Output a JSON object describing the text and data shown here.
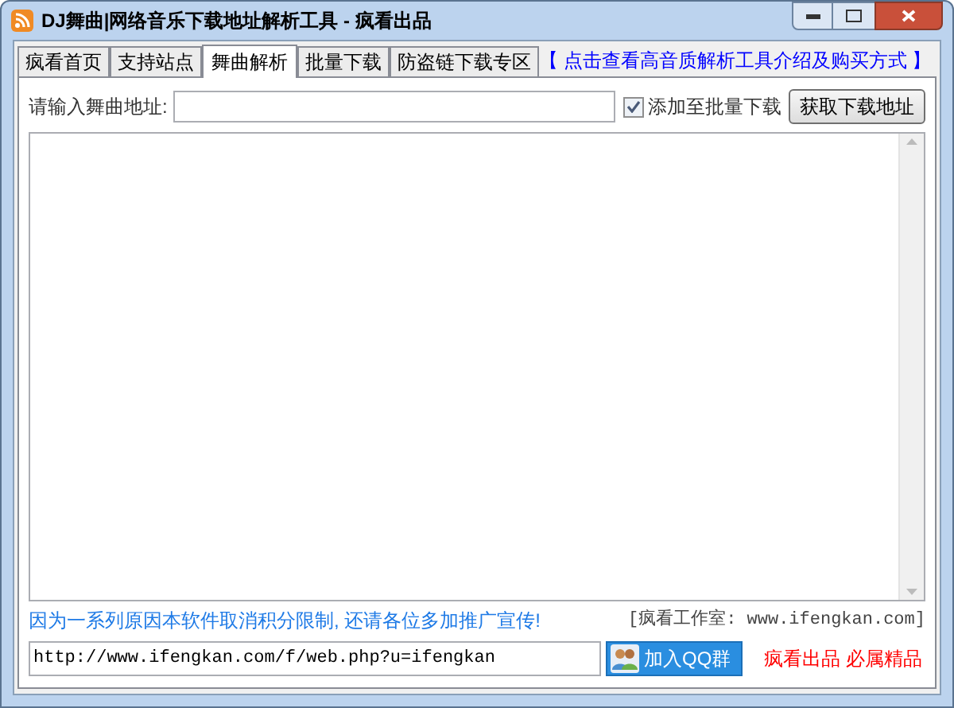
{
  "window": {
    "title": "DJ舞曲|网络音乐下载地址解析工具 - 疯看出品"
  },
  "tabs": [
    {
      "label": "疯看首页",
      "selected": false
    },
    {
      "label": "支持站点",
      "selected": false
    },
    {
      "label": "舞曲解析",
      "selected": true
    },
    {
      "label": "批量下载",
      "selected": false
    },
    {
      "label": "防盗链下载专区",
      "selected": false
    }
  ],
  "promo_link": "【 点击查看高音质解析工具介绍及购买方式 】",
  "url_field": {
    "label": "请输入舞曲地址:"
  },
  "batch_checkbox": {
    "label": "添加至批量下载",
    "checked": true
  },
  "fetch_button": "获取下载地址",
  "notice": "因为一系列原因本软件取消积分限制, 还请各位多加推广宣传!",
  "studio": "[疯看工作室: www.ifengkan.com]",
  "link_field": {
    "value": "http://www.ifengkan.com/f/web.php?u=ifengkan"
  },
  "qq_button": "加入QQ群",
  "slogan": "疯看出品 必属精品"
}
